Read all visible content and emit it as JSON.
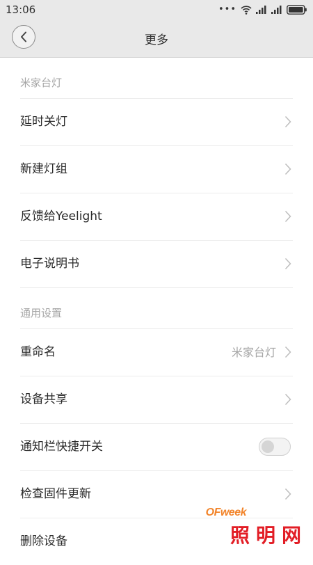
{
  "status_bar": {
    "time": "13:06",
    "signal_dots": "•••"
  },
  "header": {
    "title": "更多"
  },
  "sections": [
    {
      "title": "米家台灯",
      "items": [
        {
          "label": "延时关灯"
        },
        {
          "label": "新建灯组"
        },
        {
          "label": "反馈给Yeelight"
        },
        {
          "label": "电子说明书"
        }
      ]
    },
    {
      "title": "通用设置",
      "items": [
        {
          "label": "重命名",
          "value": "米家台灯"
        },
        {
          "label": "设备共享"
        },
        {
          "label": "通知栏快捷开关",
          "toggle_on": false
        },
        {
          "label": "检查固件更新"
        },
        {
          "label": "删除设备"
        }
      ]
    }
  ],
  "watermark": {
    "brand": "OFweek",
    "text": "照明网"
  }
}
